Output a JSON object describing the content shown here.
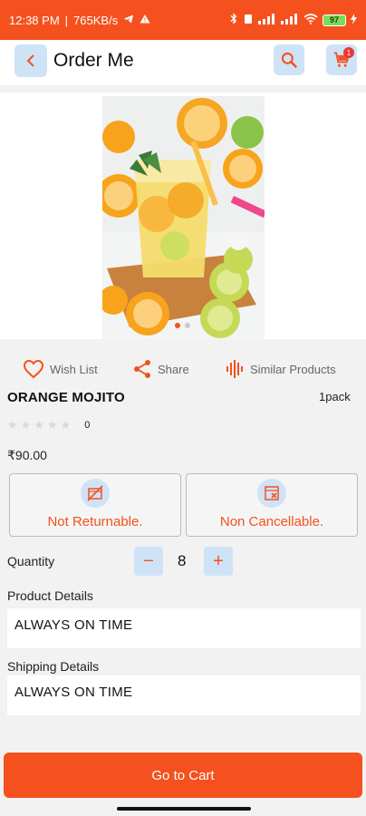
{
  "status_bar": {
    "time": "12:38 PM",
    "speed": "765KB/s",
    "battery": "97"
  },
  "app_bar": {
    "title": "Order Me",
    "cart_badge": "1"
  },
  "product": {
    "name": "ORANGE MOJITO",
    "pack": "1pack",
    "rating_count": "0",
    "rating_value": 0,
    "price": "₹90.00"
  },
  "actions": {
    "wishlist": "Wish List",
    "share": "Share",
    "similar": "Similar Products"
  },
  "policies": {
    "returnable": "Not Returnable.",
    "cancellable": "Non Cancellable."
  },
  "quantity": {
    "label": "Quantity",
    "value": "8",
    "minus": "−",
    "plus": "+"
  },
  "product_details": {
    "title": "Product Details",
    "text": "ALWAYS ON TIME"
  },
  "shipping_details": {
    "title": "Shipping Details",
    "text": "ALWAYS ON TIME"
  },
  "cta": {
    "label": "Go to Cart"
  },
  "colors": {
    "accent": "#f4511e",
    "chip": "#cfe3f7"
  }
}
